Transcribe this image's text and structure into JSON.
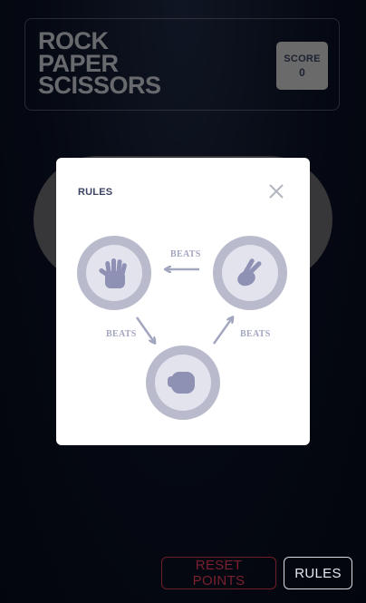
{
  "header": {
    "title_lines": [
      "ROCK",
      "PAPER",
      "SCISSORS"
    ],
    "score_label": "SCORE",
    "score_value": "0"
  },
  "modal": {
    "title": "RULES",
    "close_icon": "close-icon",
    "beats_labels": [
      "BEATS",
      "BEATS",
      "BEATS"
    ],
    "options": [
      {
        "name": "paper",
        "icon": "hand-paper-icon"
      },
      {
        "name": "scissors",
        "icon": "hand-scissors-icon"
      },
      {
        "name": "rock",
        "icon": "hand-rock-icon"
      }
    ]
  },
  "footer": {
    "reset_label": "RESET POINTS",
    "rules_label": "RULES"
  },
  "colors": {
    "background": "#0b1226",
    "accent_text": "#3b4363",
    "reset": "#7a2030",
    "icon": "#8e91b3"
  }
}
